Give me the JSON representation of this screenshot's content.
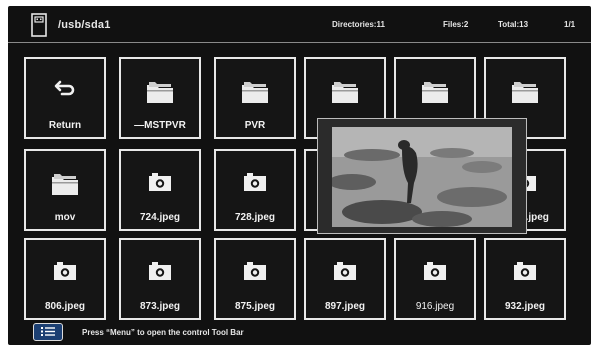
{
  "header": {
    "path": "/usb/sda1",
    "directories": "Directories:11",
    "files": "Files:2",
    "total": "Total:13",
    "page": "1/1"
  },
  "tiles": [
    {
      "label": "Return",
      "icon": "return-icon"
    },
    {
      "label": "—MSTPVR",
      "icon": "folder-icon"
    },
    {
      "label": "PVR",
      "icon": "folder-icon"
    },
    {
      "label": "",
      "icon": "folder-icon"
    },
    {
      "label": "",
      "icon": "folder-icon"
    },
    {
      "label": "",
      "icon": "folder-icon"
    },
    {
      "label": "mov",
      "icon": "folder-icon"
    },
    {
      "label": "724.jpeg",
      "icon": "camera-icon"
    },
    {
      "label": "728.jpeg",
      "icon": "camera-icon"
    },
    {
      "label": "",
      "icon": "camera-icon"
    },
    {
      "label": "",
      "icon": "camera-icon"
    },
    {
      "label": "0.jpeg",
      "icon": "camera-icon"
    },
    {
      "label": "806.jpeg",
      "icon": "camera-icon"
    },
    {
      "label": "873.jpeg",
      "icon": "camera-icon"
    },
    {
      "label": "875.jpeg",
      "icon": "camera-icon"
    },
    {
      "label": "897.jpeg",
      "icon": "camera-icon"
    },
    {
      "label": "916.jpeg",
      "icon": "camera-icon"
    },
    {
      "label": "932.jpeg",
      "icon": "camera-icon"
    }
  ],
  "footer": {
    "hint": "Press “Menu” to open the control Tool Bar",
    "menu_icon": "menu-list-icon"
  },
  "colors": {
    "background": "#111111",
    "tile_border": "#e8e8e8",
    "menu_button": "#1c3f72"
  }
}
